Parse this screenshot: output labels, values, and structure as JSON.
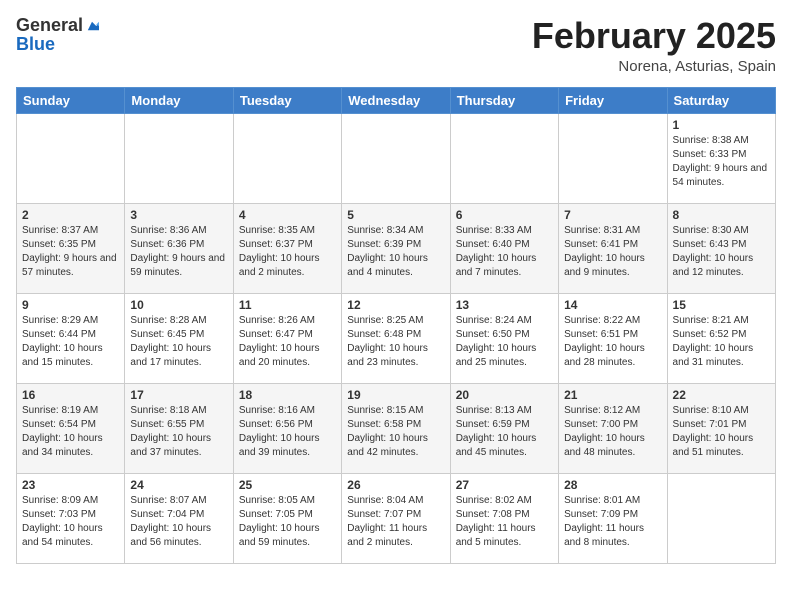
{
  "header": {
    "logo_general": "General",
    "logo_blue": "Blue",
    "title": "February 2025",
    "location": "Norena, Asturias, Spain"
  },
  "days_of_week": [
    "Sunday",
    "Monday",
    "Tuesday",
    "Wednesday",
    "Thursday",
    "Friday",
    "Saturday"
  ],
  "weeks": [
    [
      {
        "day": "",
        "info": ""
      },
      {
        "day": "",
        "info": ""
      },
      {
        "day": "",
        "info": ""
      },
      {
        "day": "",
        "info": ""
      },
      {
        "day": "",
        "info": ""
      },
      {
        "day": "",
        "info": ""
      },
      {
        "day": "1",
        "info": "Sunrise: 8:38 AM\nSunset: 6:33 PM\nDaylight: 9 hours and 54 minutes."
      }
    ],
    [
      {
        "day": "2",
        "info": "Sunrise: 8:37 AM\nSunset: 6:35 PM\nDaylight: 9 hours and 57 minutes."
      },
      {
        "day": "3",
        "info": "Sunrise: 8:36 AM\nSunset: 6:36 PM\nDaylight: 9 hours and 59 minutes."
      },
      {
        "day": "4",
        "info": "Sunrise: 8:35 AM\nSunset: 6:37 PM\nDaylight: 10 hours and 2 minutes."
      },
      {
        "day": "5",
        "info": "Sunrise: 8:34 AM\nSunset: 6:39 PM\nDaylight: 10 hours and 4 minutes."
      },
      {
        "day": "6",
        "info": "Sunrise: 8:33 AM\nSunset: 6:40 PM\nDaylight: 10 hours and 7 minutes."
      },
      {
        "day": "7",
        "info": "Sunrise: 8:31 AM\nSunset: 6:41 PM\nDaylight: 10 hours and 9 minutes."
      },
      {
        "day": "8",
        "info": "Sunrise: 8:30 AM\nSunset: 6:43 PM\nDaylight: 10 hours and 12 minutes."
      }
    ],
    [
      {
        "day": "9",
        "info": "Sunrise: 8:29 AM\nSunset: 6:44 PM\nDaylight: 10 hours and 15 minutes."
      },
      {
        "day": "10",
        "info": "Sunrise: 8:28 AM\nSunset: 6:45 PM\nDaylight: 10 hours and 17 minutes."
      },
      {
        "day": "11",
        "info": "Sunrise: 8:26 AM\nSunset: 6:47 PM\nDaylight: 10 hours and 20 minutes."
      },
      {
        "day": "12",
        "info": "Sunrise: 8:25 AM\nSunset: 6:48 PM\nDaylight: 10 hours and 23 minutes."
      },
      {
        "day": "13",
        "info": "Sunrise: 8:24 AM\nSunset: 6:50 PM\nDaylight: 10 hours and 25 minutes."
      },
      {
        "day": "14",
        "info": "Sunrise: 8:22 AM\nSunset: 6:51 PM\nDaylight: 10 hours and 28 minutes."
      },
      {
        "day": "15",
        "info": "Sunrise: 8:21 AM\nSunset: 6:52 PM\nDaylight: 10 hours and 31 minutes."
      }
    ],
    [
      {
        "day": "16",
        "info": "Sunrise: 8:19 AM\nSunset: 6:54 PM\nDaylight: 10 hours and 34 minutes."
      },
      {
        "day": "17",
        "info": "Sunrise: 8:18 AM\nSunset: 6:55 PM\nDaylight: 10 hours and 37 minutes."
      },
      {
        "day": "18",
        "info": "Sunrise: 8:16 AM\nSunset: 6:56 PM\nDaylight: 10 hours and 39 minutes."
      },
      {
        "day": "19",
        "info": "Sunrise: 8:15 AM\nSunset: 6:58 PM\nDaylight: 10 hours and 42 minutes."
      },
      {
        "day": "20",
        "info": "Sunrise: 8:13 AM\nSunset: 6:59 PM\nDaylight: 10 hours and 45 minutes."
      },
      {
        "day": "21",
        "info": "Sunrise: 8:12 AM\nSunset: 7:00 PM\nDaylight: 10 hours and 48 minutes."
      },
      {
        "day": "22",
        "info": "Sunrise: 8:10 AM\nSunset: 7:01 PM\nDaylight: 10 hours and 51 minutes."
      }
    ],
    [
      {
        "day": "23",
        "info": "Sunrise: 8:09 AM\nSunset: 7:03 PM\nDaylight: 10 hours and 54 minutes."
      },
      {
        "day": "24",
        "info": "Sunrise: 8:07 AM\nSunset: 7:04 PM\nDaylight: 10 hours and 56 minutes."
      },
      {
        "day": "25",
        "info": "Sunrise: 8:05 AM\nSunset: 7:05 PM\nDaylight: 10 hours and 59 minutes."
      },
      {
        "day": "26",
        "info": "Sunrise: 8:04 AM\nSunset: 7:07 PM\nDaylight: 11 hours and 2 minutes."
      },
      {
        "day": "27",
        "info": "Sunrise: 8:02 AM\nSunset: 7:08 PM\nDaylight: 11 hours and 5 minutes."
      },
      {
        "day": "28",
        "info": "Sunrise: 8:01 AM\nSunset: 7:09 PM\nDaylight: 11 hours and 8 minutes."
      },
      {
        "day": "",
        "info": ""
      }
    ]
  ]
}
